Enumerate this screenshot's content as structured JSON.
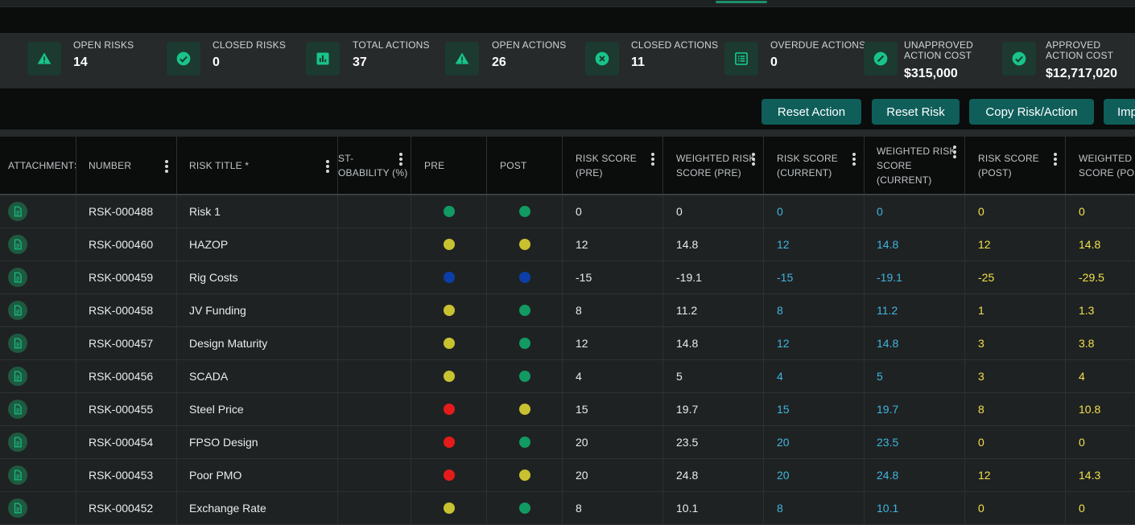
{
  "colors": {
    "accent": "#0f5e5a",
    "dot_green": "#119a62",
    "dot_yellow": "#c9c230",
    "dot_red": "#e51b1b",
    "dot_blue": "#0b3fa7",
    "current_text": "#3fb6e0",
    "post_text": "#f2e14a"
  },
  "stats": [
    {
      "label": "OPEN RISKS",
      "value": "14",
      "icon": "warning-icon"
    },
    {
      "label": "CLOSED RISKS",
      "value": "0",
      "icon": "check-circle-icon"
    },
    {
      "label": "TOTAL ACTIONS",
      "value": "37",
      "icon": "bar-chart-icon"
    },
    {
      "label": "OPEN ACTIONS",
      "value": "26",
      "icon": "warning-icon"
    },
    {
      "label": "CLOSED ACTIONS",
      "value": "11",
      "icon": "cancel-circle-icon"
    },
    {
      "label": "OVERDUE ACTIONS",
      "value": "0",
      "icon": "list-icon"
    },
    {
      "label": "UNAPPROVED ACTION COST",
      "value": "$315,000",
      "icon": "slash-circle-icon"
    },
    {
      "label": "APPROVED ACTION COST",
      "value": "$12,717,020",
      "icon": "check-circle-icon"
    }
  ],
  "buttons": {
    "reset_action": "Reset Action",
    "reset_risk": "Reset Risk",
    "copy_risk_action": "Copy Risk/Action",
    "import": "Imp"
  },
  "columns": {
    "attachments": "ATTACHMENTS",
    "number": "NUMBER",
    "risk_title": "RISK TITLE *",
    "probability_l1": "ST-",
    "probability_l2": "OBABILITY (%)",
    "pre": "PRE",
    "post": "POST",
    "risk_score_pre_l1": "RISK SCORE",
    "risk_score_pre_l2": "(PRE)",
    "weighted_pre_l1": "WEIGHTED RISK",
    "weighted_pre_l2": "SCORE (PRE)",
    "risk_score_current_l1": "RISK SCORE",
    "risk_score_current_l2": "(CURRENT)",
    "weighted_current_l1": "WEIGHTED RISK",
    "weighted_current_l2": "SCORE",
    "weighted_current_l3": "(CURRENT)",
    "risk_score_post_l1": "RISK SCORE",
    "risk_score_post_l2": "(POST)",
    "weighted_post_l1": "WEIGHTED R",
    "weighted_post_l2": "SCORE (POST"
  },
  "rows": [
    {
      "number": "RSK-000488",
      "title": "Risk 1",
      "pre": "green",
      "post": "green",
      "rs_pre": "0",
      "w_pre": "0",
      "rs_cur": "0",
      "w_cur": "0",
      "rs_post": "0",
      "w_post": "0"
    },
    {
      "number": "RSK-000460",
      "title": "HAZOP",
      "pre": "yellow",
      "post": "yellow",
      "rs_pre": "12",
      "w_pre": "14.8",
      "rs_cur": "12",
      "w_cur": "14.8",
      "rs_post": "12",
      "w_post": "14.8"
    },
    {
      "number": "RSK-000459",
      "title": "Rig Costs",
      "pre": "blue",
      "post": "blue",
      "rs_pre": "-15",
      "w_pre": "-19.1",
      "rs_cur": "-15",
      "w_cur": "-19.1",
      "rs_post": "-25",
      "w_post": "-29.5"
    },
    {
      "number": "RSK-000458",
      "title": "JV Funding",
      "pre": "yellow",
      "post": "green",
      "rs_pre": "8",
      "w_pre": "11.2",
      "rs_cur": "8",
      "w_cur": "11.2",
      "rs_post": "1",
      "w_post": "1.3"
    },
    {
      "number": "RSK-000457",
      "title": "Design Maturity",
      "pre": "yellow",
      "post": "green",
      "rs_pre": "12",
      "w_pre": "14.8",
      "rs_cur": "12",
      "w_cur": "14.8",
      "rs_post": "3",
      "w_post": "3.8"
    },
    {
      "number": "RSK-000456",
      "title": "SCADA",
      "pre": "yellow",
      "post": "green",
      "rs_pre": "4",
      "w_pre": "5",
      "rs_cur": "4",
      "w_cur": "5",
      "rs_post": "3",
      "w_post": "4"
    },
    {
      "number": "RSK-000455",
      "title": "Steel Price",
      "pre": "red",
      "post": "yellow",
      "rs_pre": "15",
      "w_pre": "19.7",
      "rs_cur": "15",
      "w_cur": "19.7",
      "rs_post": "8",
      "w_post": "10.8"
    },
    {
      "number": "RSK-000454",
      "title": "FPSO Design",
      "pre": "red",
      "post": "green",
      "rs_pre": "20",
      "w_pre": "23.5",
      "rs_cur": "20",
      "w_cur": "23.5",
      "rs_post": "0",
      "w_post": "0"
    },
    {
      "number": "RSK-000453",
      "title": "Poor PMO",
      "pre": "red",
      "post": "yellow",
      "rs_pre": "20",
      "w_pre": "24.8",
      "rs_cur": "20",
      "w_cur": "24.8",
      "rs_post": "12",
      "w_post": "14.3"
    },
    {
      "number": "RSK-000452",
      "title": "Exchange Rate",
      "pre": "yellow",
      "post": "green",
      "rs_pre": "8",
      "w_pre": "10.1",
      "rs_cur": "8",
      "w_cur": "10.1",
      "rs_post": "0",
      "w_post": "0"
    }
  ]
}
